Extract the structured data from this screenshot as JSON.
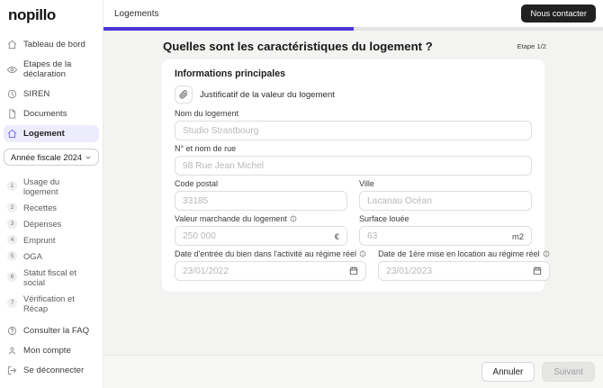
{
  "brand": "nopillo",
  "topbar": {
    "title": "Logements",
    "contact_button": "Nous contacter",
    "progress_percent": 50
  },
  "sidebar": {
    "items": [
      {
        "label": "Tableau de bord",
        "icon": "home"
      },
      {
        "label": "Etapes de la déclaration",
        "icon": "eye"
      },
      {
        "label": "SIREN",
        "icon": "clock"
      },
      {
        "label": "Documents",
        "icon": "document"
      },
      {
        "label": "Logement",
        "icon": "home",
        "active": true
      }
    ],
    "year_select": "Année fiscale 2024",
    "steps": [
      {
        "num": "1",
        "label": "Usage du logement"
      },
      {
        "num": "2",
        "label": "Recettes"
      },
      {
        "num": "3",
        "label": "Dépenses"
      },
      {
        "num": "4",
        "label": "Emprunt"
      },
      {
        "num": "5",
        "label": "OGA"
      },
      {
        "num": "6",
        "label": "Statut fiscal et social"
      },
      {
        "num": "7",
        "label": "Vérification et Récap"
      }
    ],
    "footer_items": [
      {
        "label": "Consulter la FAQ",
        "icon": "question"
      },
      {
        "label": "Mon compte",
        "icon": "person"
      },
      {
        "label": "Se déconnecter",
        "icon": "logout"
      }
    ]
  },
  "main": {
    "title": "Quelles sont les caractéristiques du logement ?",
    "step_indicator": "Etape 1/2",
    "card": {
      "heading": "Informations principales",
      "attachment_label": "Justificatif de la valeur du logement",
      "fields": {
        "nom": {
          "label": "Nom du logement",
          "placeholder": "Studio Strastbourg"
        },
        "rue": {
          "label": "N° et nom de rue",
          "placeholder": "98 Rue Jean Michel"
        },
        "code_postal": {
          "label": "Code postal",
          "placeholder": "33185"
        },
        "ville": {
          "label": "Ville",
          "placeholder": "Lacanau Océan"
        },
        "valeur": {
          "label": "Valeur marchande du logement",
          "placeholder": "250 000",
          "suffix": "€"
        },
        "surface": {
          "label": "Surface louée",
          "placeholder": "63",
          "suffix": "m2"
        },
        "date_entree": {
          "label": "Date d'entrée du bien dans l'activité au régime réel",
          "placeholder": "23/01/2022"
        },
        "date_location": {
          "label": "Date de 1ère mise en location au régime réel",
          "placeholder": "23/01/2023"
        }
      }
    },
    "footer": {
      "cancel": "Annuler",
      "next": "Suivant"
    }
  },
  "colors": {
    "accent": "#4a36d6",
    "active_item_bg": "#edecfc",
    "contact_button_bg": "#212121",
    "content_bg": "#f3f3f2"
  }
}
